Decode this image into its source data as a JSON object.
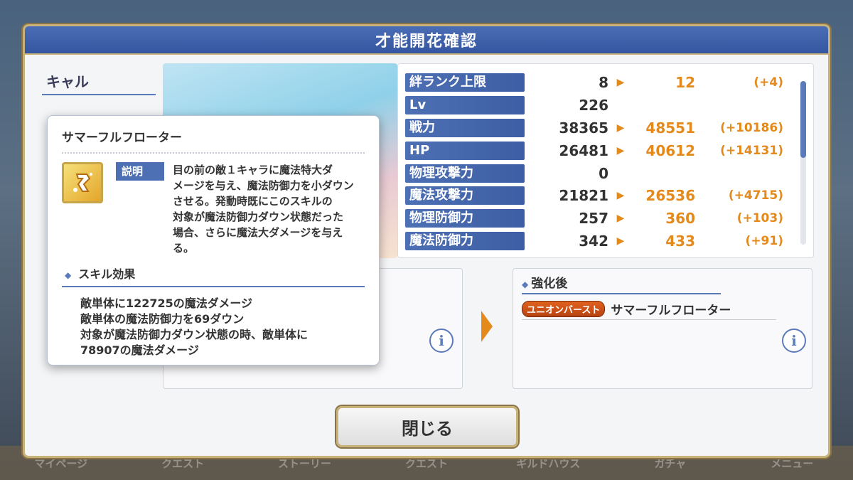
{
  "bottom_nav": [
    "マイページ",
    "クエスト",
    "ストーリー",
    "クエスト",
    "ギルドハウス",
    "ガチャ",
    "メニュー"
  ],
  "dialog": {
    "title": "才能開花確認",
    "character_name": "キャル",
    "close_label": "閉じる"
  },
  "stats": [
    {
      "label": "絆ランク上限",
      "before": "8",
      "after": "12",
      "diff": "(+4)"
    },
    {
      "label": "Lv",
      "before": "226",
      "after": "",
      "diff": ""
    },
    {
      "label": "戦力",
      "before": "38365",
      "after": "48551",
      "diff": "(+10186)"
    },
    {
      "label": "HP",
      "before": "26481",
      "after": "40612",
      "diff": "(+14131)"
    },
    {
      "label": "物理攻撃力",
      "before": "0",
      "after": "",
      "diff": ""
    },
    {
      "label": "魔法攻撃力",
      "before": "21821",
      "after": "26536",
      "diff": "(+4715)"
    },
    {
      "label": "物理防御力",
      "before": "257",
      "after": "360",
      "diff": "(+103)"
    },
    {
      "label": "魔法防御力",
      "before": "342",
      "after": "433",
      "diff": "(+91)"
    }
  ],
  "after_panel": {
    "title": "強化後",
    "badge": "ユニオンバースト",
    "skill_name": "サマーフルフローター"
  },
  "popup": {
    "title": "サマーフルフローター",
    "desc_label": "説明",
    "desc_lines": [
      "目の前の敵１キャラに魔法特大ダ",
      "メージを与え、魔法防御力を小ダウン",
      "させる。発動時既にこのスキルの",
      "対象が魔法防御力ダウン状態だった",
      "場合、さらに魔法大ダメージを与え",
      "る。"
    ],
    "effect_title": "スキル効果",
    "effects": [
      "敵単体に122725の魔法ダメージ",
      "敵単体の魔法防御力を69ダウン",
      "対象が魔法防御力ダウン状態の時、敵単体に",
      "78907の魔法ダメージ"
    ]
  },
  "icons": {
    "info": "i",
    "diamond": "◆",
    "arrow": "▶"
  },
  "colors": {
    "header_blue": "#3d5ea4",
    "accent_orange": "#e48a1c",
    "gold_border": "#c7b27a"
  }
}
